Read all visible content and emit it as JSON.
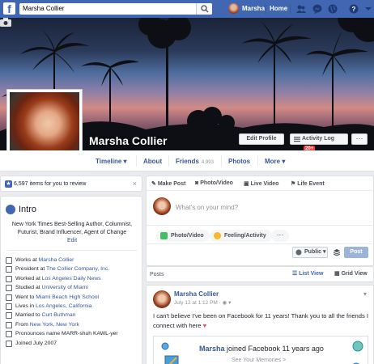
{
  "topbar": {
    "logo": "f",
    "search_value": "Marsha Collier",
    "user_name": "Marsha",
    "home_label": "Home",
    "icons": [
      "friends-icon",
      "messenger-icon",
      "globe-icon",
      "help-icon",
      "chevron-down-icon"
    ]
  },
  "profile": {
    "name": "Marsha Collier",
    "edit_profile_label": "Edit Profile",
    "activity_log_label": "Activity Log",
    "activity_badge": "20+",
    "more_label": "···"
  },
  "nav": {
    "timeline": "Timeline ▾",
    "about": "About",
    "friends": "Friends",
    "friends_count": "4,993",
    "photos": "Photos",
    "more": "More ▾"
  },
  "review": {
    "text": "6,597 items for you to review",
    "close": "×"
  },
  "intro": {
    "title": "Intro",
    "bio": "New York Times Best-Selling Author, Columnist, Futurist, Brand Influencer, Agent of Change",
    "edit": "Edit",
    "facts": [
      {
        "prefix": "Works at ",
        "link": "Marsha Collier",
        "suffix": ""
      },
      {
        "prefix": "President at ",
        "link": "The Collier Company, Inc.",
        "suffix": ""
      },
      {
        "prefix": "Worked at ",
        "link": "Los Angeles Daily News",
        "suffix": ""
      },
      {
        "prefix": "Studied at ",
        "link": "University of Miami",
        "suffix": ""
      },
      {
        "prefix": "Went to ",
        "link": "Miami Beach High School",
        "suffix": ""
      },
      {
        "prefix": "Lives in ",
        "link": "Los Angeles, California",
        "suffix": ""
      },
      {
        "prefix": "Married to ",
        "link": "Curt Buthman",
        "suffix": ""
      },
      {
        "prefix": "From ",
        "link": "New York, New York",
        "suffix": ""
      },
      {
        "prefix": "Pronounces name MARR-shuh KAWL-yer",
        "link": "",
        "suffix": ""
      },
      {
        "prefix": "Joined July 2007",
        "link": "",
        "suffix": ""
      }
    ]
  },
  "composer": {
    "tabs": [
      "Make Post",
      "Photo/Video",
      "Live Video",
      "Life Event"
    ],
    "placeholder": "What's on your mind?",
    "photo_video": "Photo/Video",
    "feeling": "Feeling/Activity",
    "more": "···",
    "audience": "Public ▾",
    "post_label": "Post"
  },
  "posts_bar": {
    "label": "Posts",
    "list_view": "List View",
    "grid_view": "Grid View"
  },
  "post": {
    "author": "Marsha Collier",
    "meta": "July 12 at 1:12 PM · ◉ ▾",
    "text": "I can't believe I've been on Facebook for 11 years! Thank you to all the friends I connect with here",
    "heart": "♥",
    "memory_name": "Marsha",
    "memory_text": " joined Facebook 11 years ago",
    "memory_sub": "See Your Memories >"
  },
  "colors": {
    "brand": "#4267b2",
    "link": "#365899",
    "background": "#e9ebee"
  }
}
